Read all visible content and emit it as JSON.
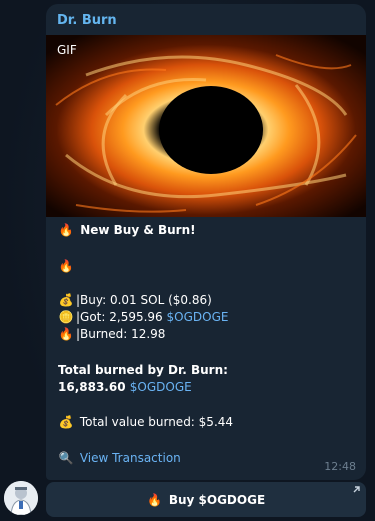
{
  "sender": {
    "name": "Dr. Burn"
  },
  "media": {
    "badge": "GIF"
  },
  "message": {
    "headline_emoji": "🔥",
    "headline": "New Buy & Burn!",
    "fire_line": "🔥",
    "buy": {
      "emoji": "💰",
      "text": "|Buy: 0.01 SOL ($0.86)"
    },
    "got": {
      "emoji": "🪙",
      "text": "|Got: 2,595.96 ",
      "ticker": "$OGDOGE"
    },
    "burned": {
      "emoji": "🔥",
      "text": "|Burned: 12.98"
    },
    "total_label": "Total burned by Dr. Burn:",
    "total_value": "16,883.60 ",
    "total_ticker": "$OGDOGE",
    "value": {
      "emoji": "💰",
      "text": "Total value burned: $5.44"
    },
    "view": {
      "emoji": "🔍",
      "text": "View Transaction"
    },
    "time": "12:48"
  },
  "button": {
    "emoji": "🔥",
    "label": "Buy $OGDOGE"
  },
  "colors": {
    "link": "#6ab3f3",
    "sender": "#64b5ef",
    "bubble": "#182533",
    "background": "#0e1621"
  }
}
